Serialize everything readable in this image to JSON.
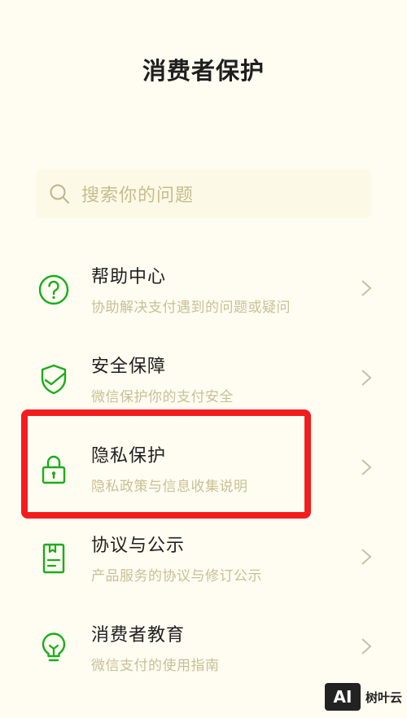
{
  "header": {
    "title": "消费者保护"
  },
  "search": {
    "placeholder": "搜索你的问题",
    "icon": "search-icon"
  },
  "menu": {
    "items": [
      {
        "title": "帮助中心",
        "subtitle": "协助解决支付遇到的问题或疑问",
        "icon": "help-question-icon"
      },
      {
        "title": "安全保障",
        "subtitle": "微信保护你的支付安全",
        "icon": "shield-check-icon"
      },
      {
        "title": "隐私保护",
        "subtitle": "隐私政策与信息收集说明",
        "icon": "lock-icon"
      },
      {
        "title": "协议与公示",
        "subtitle": "产品服务的协议与修订公示",
        "icon": "document-icon"
      },
      {
        "title": "消费者教育",
        "subtitle": "微信支付的使用指南",
        "icon": "lightbulb-icon"
      }
    ]
  },
  "highlight": {
    "target": "隐私保护",
    "color": "#f41d1d"
  },
  "watermark": {
    "logo": "AI",
    "text": "树叶云"
  },
  "colors": {
    "accent": "#1aad19",
    "background": "#fffdf2",
    "subtitle": "#c9bf94"
  }
}
